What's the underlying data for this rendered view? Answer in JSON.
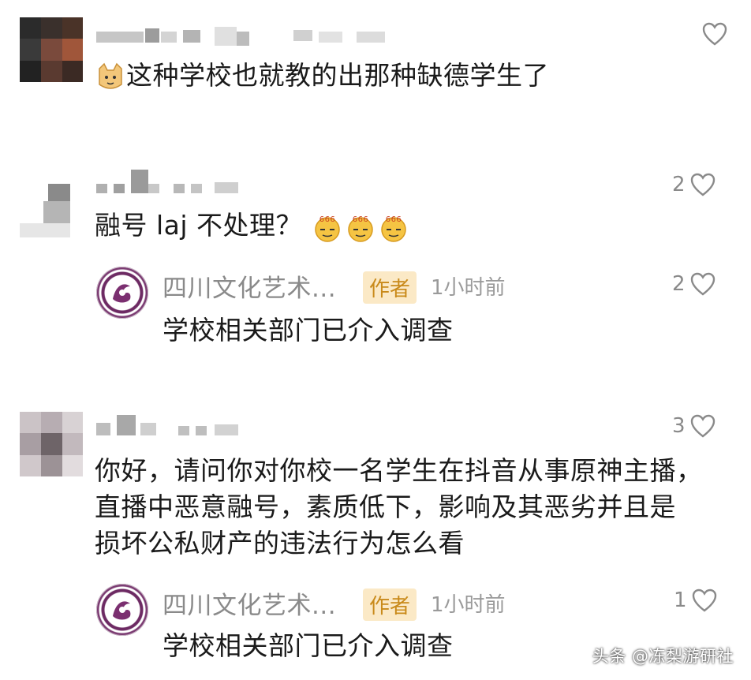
{
  "comments": [
    {
      "text": "这种学校也就教的出那种缺德学生了",
      "likes": "",
      "emoji": "cat-emoji"
    },
    {
      "text": "融号 laj 不处理？",
      "likes": "2",
      "emoji": "666-emoji",
      "reply": {
        "name": "四川文化艺术...",
        "badge": "作者",
        "time": "1小时前",
        "text": "学校相关部门已介入调查",
        "likes": "2"
      }
    },
    {
      "lines": [
        "你好，请问你对你校一名学生在抖音从事原神主播，",
        "直播中恶意融号，素质低下，影响及其恶劣并且是",
        "损坏公私财产的违法行为怎么看"
      ],
      "likes": "3",
      "reply": {
        "name": "四川文化艺术...",
        "badge": "作者",
        "time": "1小时前",
        "text": "学校相关部门已介入调查",
        "likes": "1"
      }
    }
  ],
  "watermark": "头条 @冻梨游研社",
  "colors": {
    "badge_bg": "#fbe9c6",
    "badge_text": "#c98a1a",
    "muted": "#8a8a8a",
    "avatar_purple": "#6d2a63"
  }
}
